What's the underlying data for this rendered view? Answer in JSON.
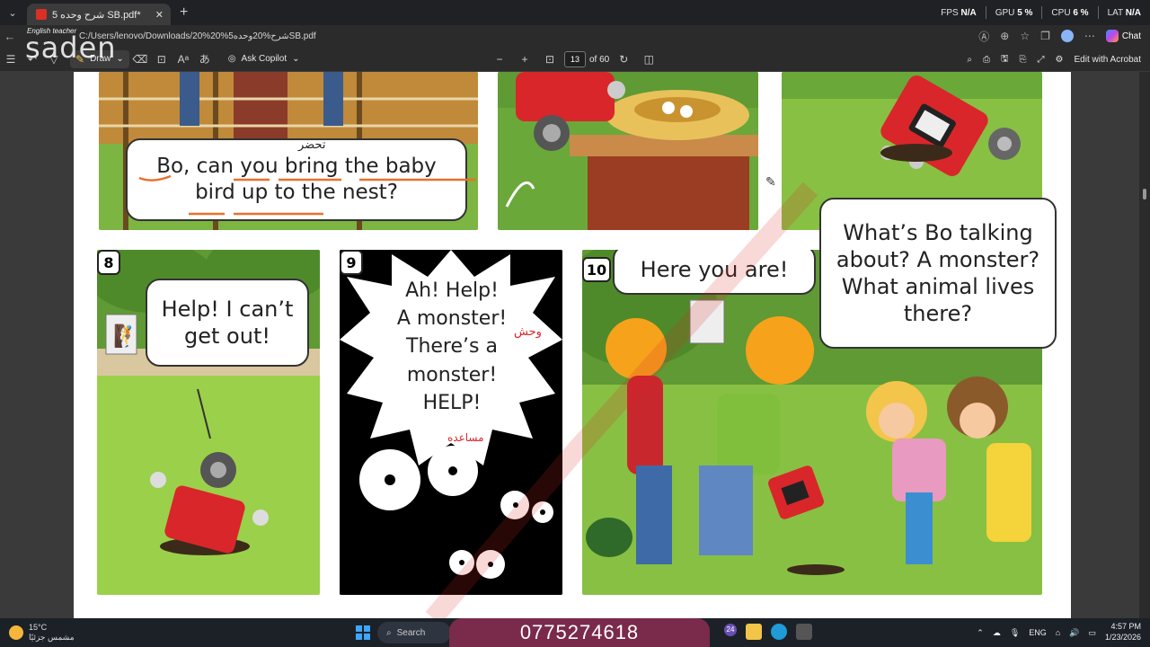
{
  "browser": {
    "tab_title": "شرح وحده 5 SB.pdf*",
    "url": "C:/Users/lenovo/Downloads/20%شرح%20وحده5%20SB.pdf",
    "perf": {
      "fps_label": "FPS",
      "fps_value": "N/A",
      "gpu_label": "GPU",
      "gpu_value": "5 %",
      "cpu_label": "CPU",
      "cpu_value": "6 %",
      "lat_label": "LAT",
      "lat_value": "N/A"
    },
    "chat_label": "Chat"
  },
  "pdf_toolbar": {
    "draw_label": "Draw",
    "ask_copilot_label": "Ask Copilot",
    "page_number": "13",
    "page_total": "of 60",
    "edit_label": "Edit with Acrobat"
  },
  "watermark": {
    "brand": "saden",
    "tagline": "English teacher"
  },
  "comic": {
    "panel7_bubble_line1": "Bo, can you bring the baby",
    "panel7_bubble_line2": "bird up to the nest?",
    "panel7_arabic": "تحضر",
    "panel8_number": "8",
    "panel8_bubble": "Help! I can’t get out!",
    "panel9_number": "9",
    "panel9_bubble_1": "Ah! Help!",
    "panel9_bubble_2": "A monster!",
    "panel9_bubble_3": "There’s a",
    "panel9_bubble_4": "monster!",
    "panel9_bubble_5": "HELP!",
    "panel9_arabic_monster": "وحش",
    "panel9_arabic_help": "مساعده",
    "panel10_number": "10",
    "panel10_bubble_left": "Here you are!",
    "panel10_bubble_right_1": "What’s Bo talking",
    "panel10_bubble_right_2": "about? A monster?",
    "panel10_bubble_right_3": "What animal lives",
    "panel10_bubble_right_4": "there?"
  },
  "taskbar": {
    "temperature": "15°C",
    "weather_text": "مشمس جزئيًا",
    "search_label": "Search",
    "phone_number": "0775274618",
    "lang": "ENG",
    "time": "4:57 PM",
    "date": "1/23/2026",
    "notification_count": "24"
  },
  "colors": {
    "robot_red": "#d9262a",
    "grass_green": "#8cc63f",
    "helmet_orange": "#f7a21b",
    "accent_underline": "#e8712b"
  }
}
